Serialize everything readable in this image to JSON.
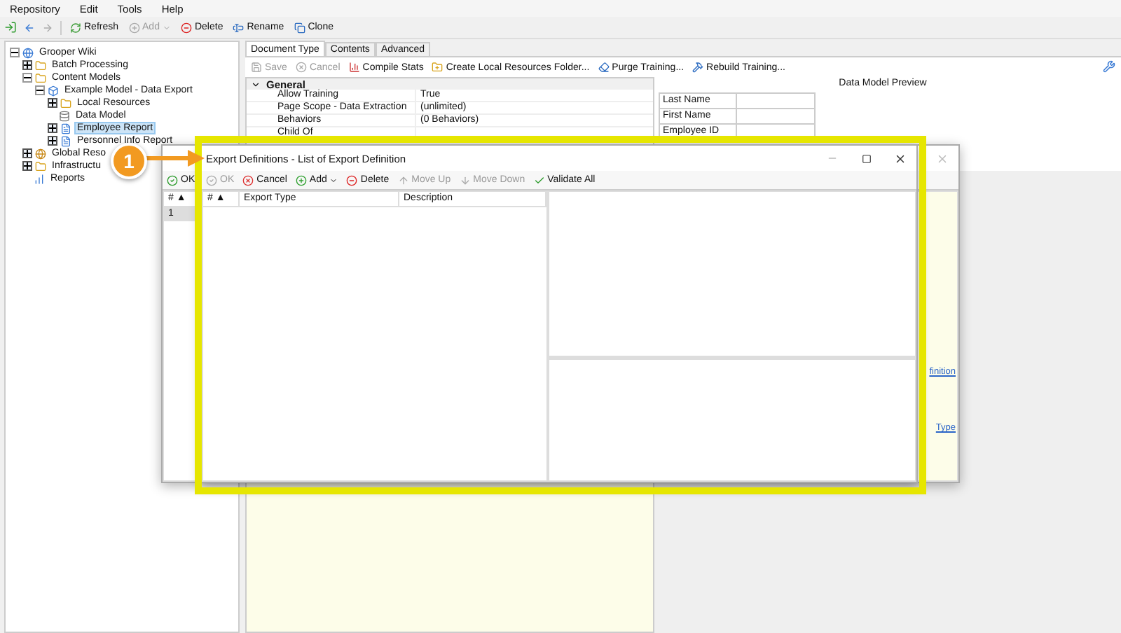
{
  "menu": [
    "Repository",
    "Edit",
    "Tools",
    "Help"
  ],
  "toolbar": [
    {
      "label": "Refresh",
      "kind": "refresh",
      "disabled": false
    },
    {
      "label": "Add",
      "kind": "add",
      "disabled": true,
      "dropdown": true
    },
    {
      "label": "Delete",
      "kind": "delete",
      "disabled": false
    },
    {
      "label": "Rename",
      "kind": "rename",
      "disabled": false
    },
    {
      "label": "Clone",
      "kind": "clone",
      "disabled": false
    }
  ],
  "tree": [
    {
      "label": "Grooper Wiki",
      "kind": "root",
      "expanded": true,
      "selected": false,
      "children": [
        {
          "label": "Batch Processing",
          "kind": "folder",
          "expanded": false,
          "selected": false
        },
        {
          "label": "Content Models",
          "kind": "folder",
          "expanded": true,
          "selected": false,
          "children": [
            {
              "label": "Example Model - Data Export",
              "kind": "model",
              "expanded": true,
              "selected": false,
              "children": [
                {
                  "label": "Local Resources",
                  "kind": "folder",
                  "expanded": false,
                  "selected": false
                },
                {
                  "label": "Data Model",
                  "kind": "datamodel",
                  "selected": false
                },
                {
                  "label": "Employee Report",
                  "kind": "doc",
                  "expanded": false,
                  "selected": true
                },
                {
                  "label": "Personnel Info Report",
                  "kind": "doc",
                  "expanded": false,
                  "selected": false
                }
              ]
            }
          ]
        },
        {
          "label": "Global Reso",
          "kind": "globe",
          "expanded": false,
          "selected": false
        },
        {
          "label": "Infrastructu",
          "kind": "folder",
          "expanded": false,
          "selected": false
        },
        {
          "label": "Reports",
          "kind": "reports",
          "selected": false
        }
      ]
    }
  ],
  "tabs": [
    {
      "label": "Document Type",
      "selected": true
    },
    {
      "label": "Contents",
      "selected": false
    },
    {
      "label": "Advanced",
      "selected": false
    }
  ],
  "doc_toolbar": [
    {
      "label": "Save",
      "kind": "save",
      "disabled": true
    },
    {
      "label": "Cancel",
      "kind": "cancel",
      "disabled": true
    },
    {
      "label": "Compile Stats",
      "kind": "stats",
      "disabled": false
    },
    {
      "label": "Create Local Resources Folder...",
      "kind": "folder",
      "disabled": false
    },
    {
      "label": "Purge Training...",
      "kind": "purge",
      "disabled": false
    },
    {
      "label": "Rebuild Training...",
      "kind": "rebuild",
      "disabled": false
    }
  ],
  "properties": {
    "category": "General",
    "expanded": true,
    "rows": [
      {
        "name": "Allow Training",
        "value": "True"
      },
      {
        "name": "Page Scope - Data Extraction",
        "value": "(unlimited)"
      },
      {
        "name": "Behaviors",
        "value": "(0 Behaviors)"
      },
      {
        "name": "Child Of"
      }
    ]
  },
  "preview": {
    "title": "Data Model Preview",
    "fields": [
      "Last Name",
      "First Name",
      "Employee ID"
    ]
  },
  "back_dialog": {
    "toolbar": [
      {
        "label": "OK",
        "kind": "ok",
        "disabled": false
      }
    ],
    "columns": [
      "# ▲"
    ],
    "rows": [
      {
        "cells": [
          "1"
        ],
        "selected": true
      }
    ],
    "links": [
      "finition",
      "Type"
    ]
  },
  "dialog": {
    "title": "Export Definitions - List of Export Definition",
    "toolbar": [
      {
        "label": "OK",
        "kind": "ok",
        "disabled": true
      },
      {
        "label": "Cancel",
        "kind": "cancel",
        "disabled": false
      },
      {
        "label": "Add",
        "kind": "add",
        "disabled": false,
        "dropdown": true
      },
      {
        "label": "Delete",
        "kind": "delete",
        "disabled": false
      },
      {
        "label": "Move Up",
        "kind": "up",
        "disabled": true
      },
      {
        "label": "Move Down",
        "kind": "down",
        "disabled": true
      },
      {
        "label": "Validate All",
        "kind": "validate",
        "disabled": false
      }
    ],
    "columns": [
      "# ▲",
      "Export Type",
      "Description"
    ]
  },
  "callout": {
    "number": "1"
  }
}
